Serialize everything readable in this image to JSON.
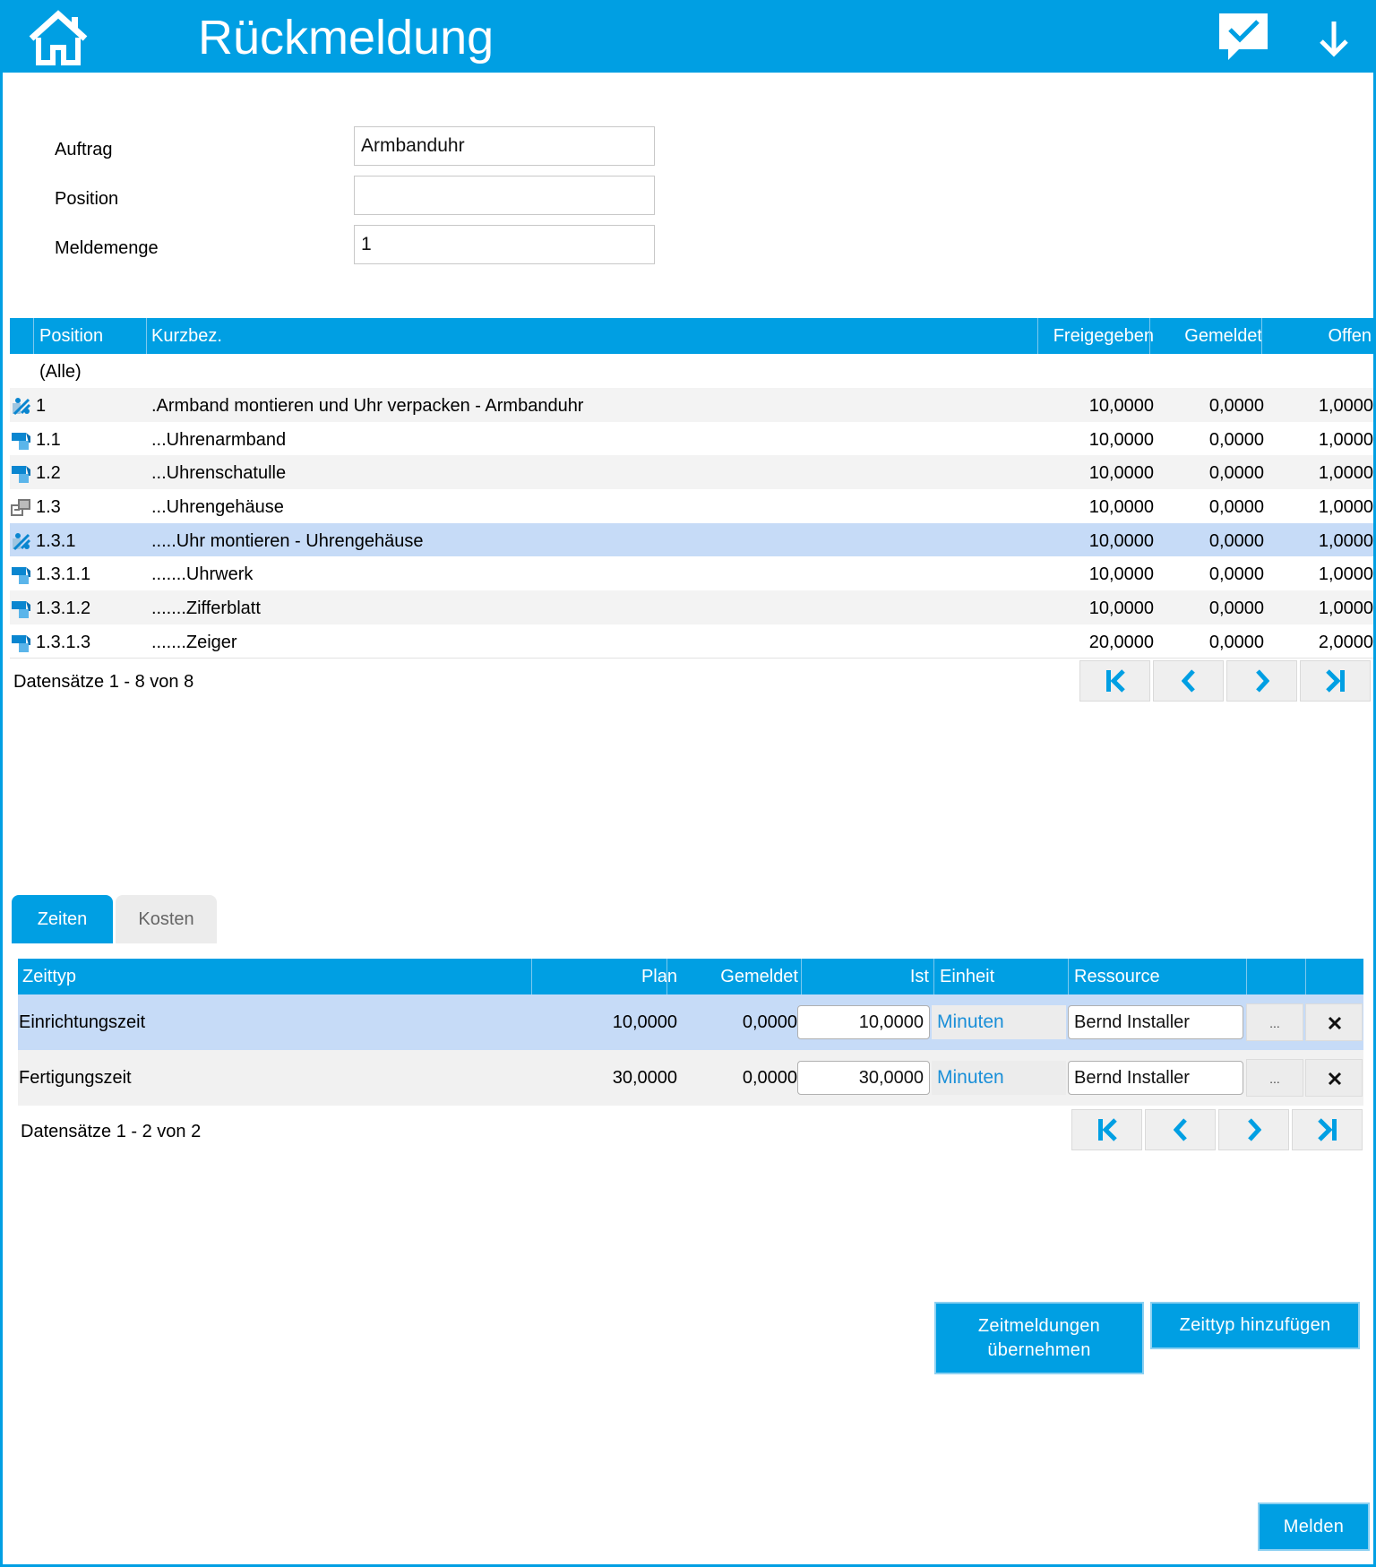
{
  "header": {
    "title": "Rückmeldung",
    "accent": "#009fe3"
  },
  "form": {
    "auftrag_label": "Auftrag",
    "auftrag_value": "Armbanduhr",
    "position_label": "Position",
    "position_value": "",
    "meldemenge_label": "Meldemenge",
    "meldemenge_value": "1"
  },
  "positions": {
    "columns": {
      "position": "Position",
      "kurzbez": "Kurzbez.",
      "freigegeben": "Freigegeben",
      "gemeldet": "Gemeldet",
      "offen": "Offen"
    },
    "all_label": "(Alle)",
    "rows": [
      {
        "icon": "assembly-icon",
        "position": "1",
        "kurzbez": ".Armband montieren und Uhr verpacken - Armbanduhr",
        "freigegeben": "10,0000",
        "gemeldet": "0,0000",
        "offen": "1,0000"
      },
      {
        "icon": "material-icon",
        "position": "1.1",
        "kurzbez": "...Uhrenarmband",
        "freigegeben": "10,0000",
        "gemeldet": "0,0000",
        "offen": "1,0000"
      },
      {
        "icon": "material-icon",
        "position": "1.2",
        "kurzbez": "...Uhrenschatulle",
        "freigegeben": "10,0000",
        "gemeldet": "0,0000",
        "offen": "1,0000"
      },
      {
        "icon": "subassembly-icon",
        "position": "1.3",
        "kurzbez": "...Uhrengehäuse",
        "freigegeben": "10,0000",
        "gemeldet": "0,0000",
        "offen": "1,0000"
      },
      {
        "icon": "assembly-icon",
        "position": "1.3.1",
        "kurzbez": ".....Uhr montieren - Uhrengehäuse",
        "freigegeben": "10,0000",
        "gemeldet": "0,0000",
        "offen": "1,0000"
      },
      {
        "icon": "material-icon",
        "position": "1.3.1.1",
        "kurzbez": ".......Uhrwerk",
        "freigegeben": "10,0000",
        "gemeldet": "0,0000",
        "offen": "1,0000"
      },
      {
        "icon": "material-icon",
        "position": "1.3.1.2",
        "kurzbez": ".......Zifferblatt",
        "freigegeben": "10,0000",
        "gemeldet": "0,0000",
        "offen": "1,0000"
      },
      {
        "icon": "material-icon",
        "position": "1.3.1.3",
        "kurzbez": ".......Zeiger",
        "freigegeben": "20,0000",
        "gemeldet": "0,0000",
        "offen": "2,0000"
      }
    ],
    "records_label": "Datensätze 1 - 8 von 8"
  },
  "tabs": {
    "zeiten": "Zeiten",
    "kosten": "Kosten"
  },
  "times": {
    "columns": {
      "zeittyp": "Zeittyp",
      "plan": "Plan",
      "gemeldet": "Gemeldet",
      "ist": "Ist",
      "einheit": "Einheit",
      "ressource": "Ressource"
    },
    "rows": [
      {
        "zeittyp": "Einrichtungszeit",
        "plan": "10,0000",
        "gemeldet": "0,0000",
        "ist": "10,0000",
        "einheit": "Minuten",
        "ressource": "Bernd Installer",
        "more": "..."
      },
      {
        "zeittyp": "Fertigungszeit",
        "plan": "30,0000",
        "gemeldet": "0,0000",
        "ist": "30,0000",
        "einheit": "Minuten",
        "ressource": "Bernd Installer",
        "more": "..."
      }
    ],
    "records_label": "Datensätze 1 - 2 von 2"
  },
  "actions": {
    "zeitmeldungen_line1": "Zeitmeldungen",
    "zeitmeldungen_line2": "übernehmen",
    "zeittyp_hinzufuegen": "Zeittyp hinzufügen",
    "melden": "Melden"
  }
}
